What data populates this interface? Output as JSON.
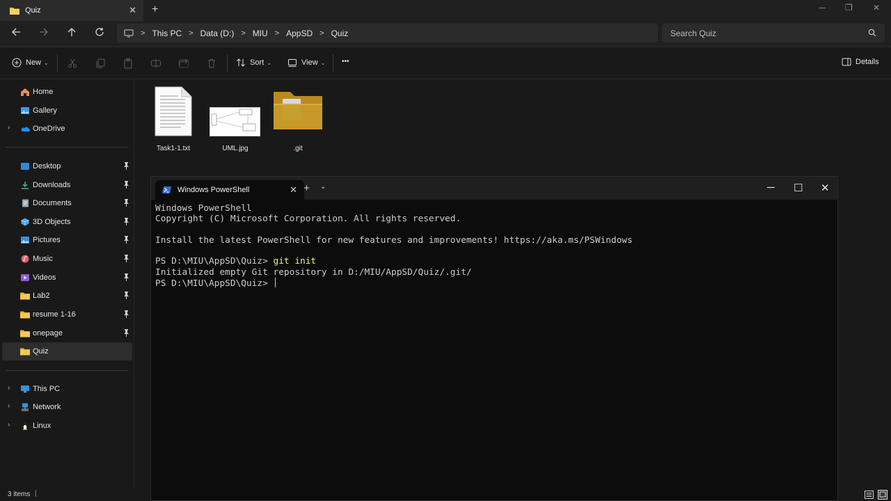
{
  "explorer": {
    "tab": {
      "title": "Quiz"
    },
    "breadcrumb": [
      "This PC",
      "Data (D:)",
      "MIU",
      "AppSD",
      "Quiz"
    ],
    "search": {
      "placeholder": "Search Quiz"
    },
    "toolbar": {
      "new_label": "New",
      "sort_label": "Sort",
      "view_label": "View",
      "more_label": "•••",
      "details_label": "Details"
    },
    "sidebar": {
      "top": [
        {
          "label": "Home",
          "icon": "home-icon"
        },
        {
          "label": "Gallery",
          "icon": "gallery-icon"
        },
        {
          "label": "OneDrive",
          "icon": "onedrive-icon"
        }
      ],
      "pinned": [
        {
          "label": "Desktop",
          "icon": "desktop-icon"
        },
        {
          "label": "Downloads",
          "icon": "downloads-icon"
        },
        {
          "label": "Documents",
          "icon": "documents-icon"
        },
        {
          "label": "3D Objects",
          "icon": "3d-objects-icon"
        },
        {
          "label": "Pictures",
          "icon": "pictures-icon"
        },
        {
          "label": "Music",
          "icon": "music-icon"
        },
        {
          "label": "Videos",
          "icon": "videos-icon"
        },
        {
          "label": "Lab2",
          "icon": "folder-icon"
        },
        {
          "label": "resume 1-16",
          "icon": "folder-icon"
        },
        {
          "label": "onepage",
          "icon": "folder-icon"
        },
        {
          "label": "Quiz",
          "icon": "folder-icon"
        }
      ],
      "bottom": [
        {
          "label": "This PC",
          "icon": "this-pc-icon"
        },
        {
          "label": "Network",
          "icon": "network-icon"
        },
        {
          "label": "Linux",
          "icon": "linux-icon"
        }
      ]
    },
    "files": [
      {
        "name": "Task1-1.txt",
        "icon": "text-file-icon"
      },
      {
        "name": "UML.jpg",
        "icon": "image-thumbnail"
      },
      {
        "name": ".git",
        "icon": "folder-icon"
      }
    ],
    "status": {
      "item_count": "3 items"
    }
  },
  "terminal": {
    "tab_title": "Windows PowerShell",
    "lines": {
      "l1": "Windows PowerShell",
      "l2": "Copyright (C) Microsoft Corporation. All rights reserved.",
      "l3": "",
      "l4": "Install the latest PowerShell for new features and improvements! https://aka.ms/PSWindows",
      "l5": "",
      "l6_prompt": "PS D:\\MIU\\AppSD\\Quiz> ",
      "l6_cmd": "git init",
      "l7": "Initialized empty Git repository in D:/MIU/AppSD/Quiz/.git/",
      "l8_prompt": "PS D:\\MIU\\AppSD\\Quiz> "
    }
  },
  "colors": {
    "background": "#191919",
    "terminal_bg": "#0c0c0c",
    "command_highlight": "#f1f08c",
    "folder_yellow": "#f2c14e"
  }
}
